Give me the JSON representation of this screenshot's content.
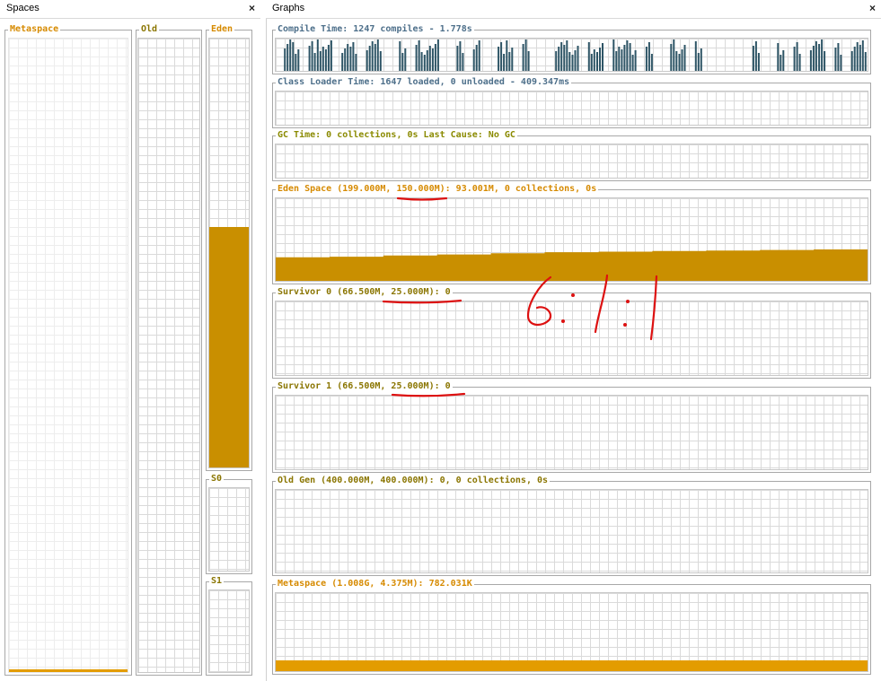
{
  "colors": {
    "accent": "#d68a00",
    "eden_fill": "#c98f00",
    "meta_fill": "#e39c00",
    "compile_bars": "#2e5566",
    "annotation": "#dd1111"
  },
  "spaces_panel": {
    "title": "Spaces",
    "close_glyph": "×",
    "metaspace_label": "Metaspace",
    "old_label": "Old",
    "eden_label": "Eden",
    "s0_label": "S0",
    "s1_label": "S1",
    "eden_fill_fraction": 0.56,
    "metaspace_fill_fraction": 0.005,
    "old_fill_fraction": 0,
    "s0_fill_fraction": 0,
    "s1_fill_fraction": 0
  },
  "graphs_panel": {
    "title": "Graphs",
    "close_glyph": "×",
    "compile_label": "Compile Time: 1247 compiles - 1.778s",
    "classloader_label": "Class Loader Time: 1647 loaded, 0 unloaded - 409.347ms",
    "gc_label": "GC Time: 0 collections, 0s Last Cause: No GC",
    "eden_label": "Eden Space (199.000M, 150.000M): 93.001M, 0 collections, 0s",
    "survivor0_label": "Survivor 0 (66.500M, 25.000M): 0",
    "survivor1_label": "Survivor 1 (66.500M, 25.000M): 0",
    "oldgen_label": "Old Gen (400.000M, 400.000M): 0, 0 collections, 0s",
    "metaspace_label": "Metaspace (1.008G, 4.375M): 782.031K",
    "eden_usage_steps": [
      0.42,
      0.43,
      0.45,
      0.47,
      0.49,
      0.51,
      0.52,
      0.53,
      0.54,
      0.55,
      0.56
    ],
    "compile_activity": [
      0,
      1,
      1,
      0,
      1,
      1,
      1,
      0,
      1,
      1,
      0,
      1,
      1,
      0,
      0,
      1,
      0,
      1,
      1,
      1,
      0,
      0,
      1,
      0,
      1,
      0,
      0,
      1,
      1,
      0,
      1,
      0,
      0,
      0,
      1,
      1,
      1,
      0,
      1,
      1,
      0,
      1,
      1,
      1,
      0,
      1,
      0,
      0,
      1,
      1,
      0,
      1,
      0,
      0,
      0,
      0,
      0,
      0,
      1,
      0,
      0,
      1,
      0,
      1,
      0,
      1,
      1,
      0,
      1,
      0,
      1,
      1
    ],
    "metaspace_usage_fraction": 0.14
  },
  "annotation": {
    "ratio_text": "6:1:1"
  }
}
